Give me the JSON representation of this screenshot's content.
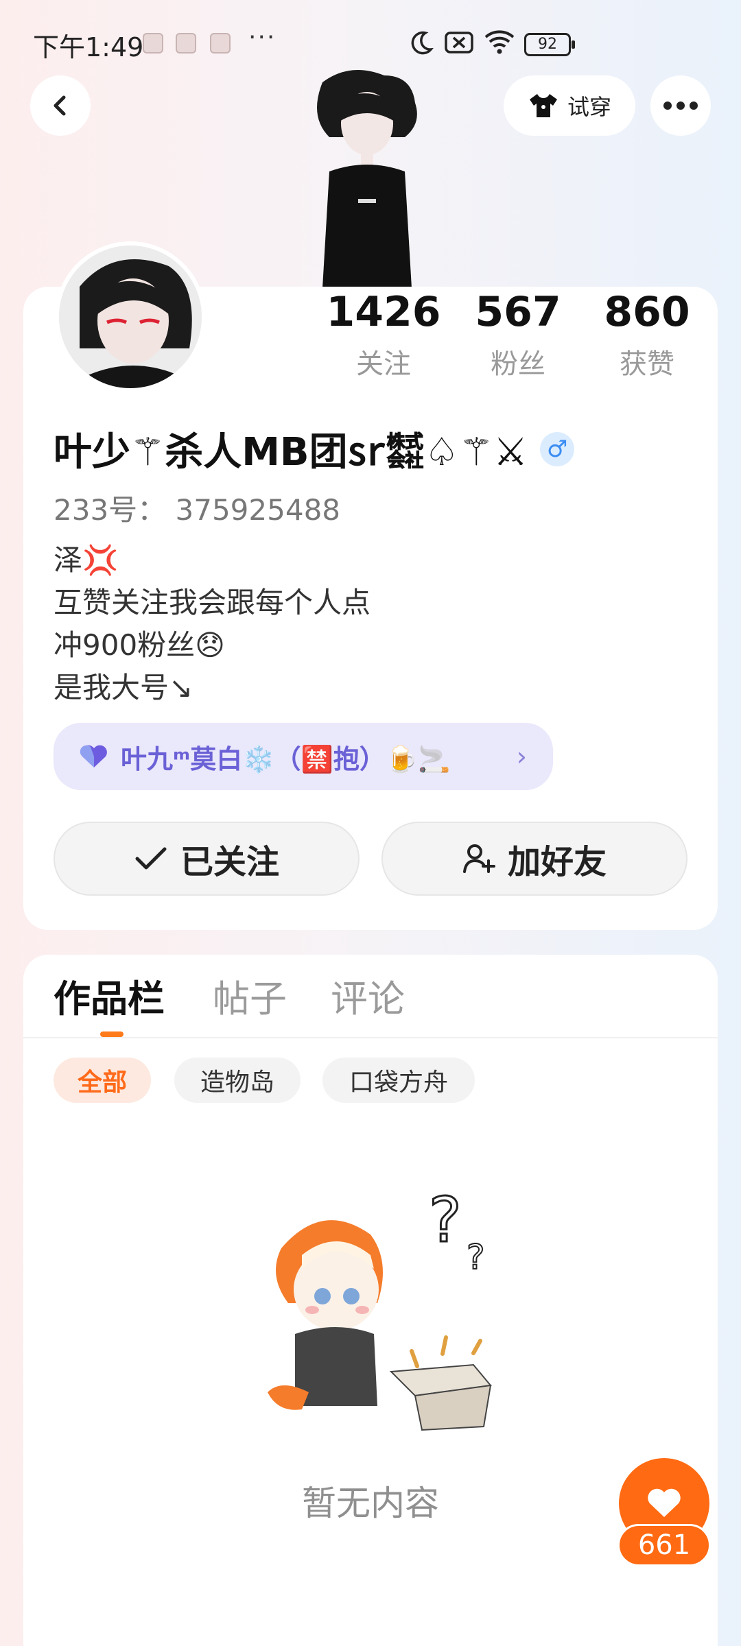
{
  "status_bar": {
    "time": "下午1:49",
    "dots": "···",
    "battery": "92"
  },
  "nav": {
    "tryon_label": "试穿"
  },
  "profile": {
    "stats": [
      {
        "num": "1426",
        "label": "关注"
      },
      {
        "num": "567",
        "label": "粉丝"
      },
      {
        "num": "860",
        "label": "获赞"
      }
    ],
    "username": "叶少⚚杀人MB团㏛㍿♤⚚⚔",
    "gender_symbol": "♂",
    "id_line": "233号：  375925488",
    "bio": "泽💢\n互赞关注我会跟每个人点\n冲900粉丝😞\n是我大号↘",
    "group_label": "叶九ᵐ莫白❄️（🈲抱）🍺🚬",
    "follow_button": "已关注",
    "add_friend_button": "加好友"
  },
  "works": {
    "tabs": [
      "作品栏",
      "帖子",
      "评论"
    ],
    "filters": [
      "全部",
      "造物岛",
      "口袋方舟"
    ],
    "empty_text": "暂无内容"
  },
  "like_fab": {
    "count": "661"
  },
  "colors": {
    "accent": "#ff6a12",
    "group_pill_bg": "#eae8fb",
    "group_text": "#6b61d6",
    "gender": "#3b8df2"
  }
}
